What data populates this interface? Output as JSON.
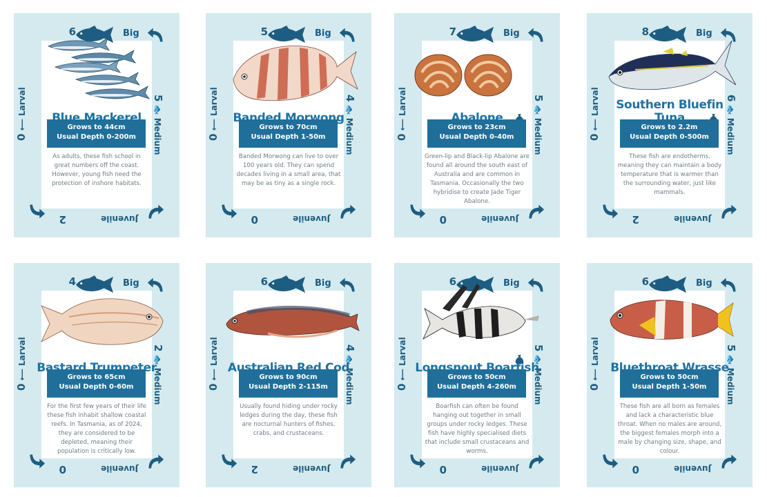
{
  "labels": {
    "big": "Big",
    "medium": "Medium",
    "juvenile": "Juvenile",
    "larval": "Larval",
    "larval_num": "0"
  },
  "colors": {
    "card_bg": "#d4eaef",
    "brand_blue": "#1f6f9a",
    "text_grey": "#6c7e86"
  },
  "cards": [
    {
      "name": "Blue Mackerel",
      "big": "6",
      "medium": "5",
      "juvenile": "2",
      "grows": "Grows to 44cm",
      "depth": "Usual Depth 0-200m",
      "desc": "As adults, these fish school in great numbers off the coast. However, young fish need the protection of inshore habitats.",
      "has_bag_icon": false,
      "illustration": "mackerel-school-illustration"
    },
    {
      "name": "Banded Morwong",
      "big": "5",
      "medium": "4",
      "juvenile": "0",
      "grows": "Grows to 70cm",
      "depth": "Usual Depth 1-50m",
      "desc": "Banded Morwong can live to over 100 years old. They can spend decades living in a small area, that may be as tiny as a single rock.",
      "has_bag_icon": false,
      "illustration": "banded-morwong-illustration"
    },
    {
      "name": "Abalone",
      "big": "7",
      "medium": "5",
      "juvenile": "0",
      "grows": "Grows to 23cm",
      "depth": "Usual Depth 0-40m",
      "desc": "Green-lip and Black-lip Abalone are found all around the south east of Australia and are common in Tasmania. Occasionally the two hybridise to create Jade Tiger Abalone.",
      "has_bag_icon": true,
      "illustration": "abalone-shells-illustration"
    },
    {
      "name": "Southern Bluefin Tuna",
      "big": "8",
      "medium": "6",
      "juvenile": "2",
      "grows": "Grows to 2.2m",
      "depth": "Usual Depth 0-500m",
      "desc": "These fish are endotherms, meaning they can maintain a body temperature that is warmer than the surrounding water, just like mammals.",
      "has_bag_icon": true,
      "illustration": "bluefin-tuna-illustration"
    },
    {
      "name": "Bastard Trumpeter",
      "big": "4",
      "medium": "2",
      "juvenile": "0",
      "grows": "Grows to 65cm",
      "depth": "Usual Depth 0-60m",
      "desc": "For the first few years of their life these fish inhabit shallow coastal reefs. In Tasmania, as of 2024, they are considered to be depleted, meaning their population is critically low.",
      "has_bag_icon": false,
      "illustration": "bastard-trumpeter-illustration"
    },
    {
      "name": "Australian Red Cod",
      "big": "6",
      "medium": "4",
      "juvenile": "2",
      "grows": "Grows to 90cm",
      "depth": "Usual Depth 2-115m",
      "desc": "Usually found hiding under rocky ledges during the day, these fish are nocturnal hunters of fishes, crabs, and crustaceans.",
      "has_bag_icon": false,
      "illustration": "red-cod-illustration"
    },
    {
      "name": "Longsnout Boarfish",
      "big": "6",
      "medium": "5",
      "juvenile": "0",
      "grows": "Grows to 50cm",
      "depth": "Usual Depth 4-260m",
      "desc": "Boarfish can often be found hanging out together in small groups under rocky ledges. These fish have highly specialised diets that include small crustaceans and worms.",
      "has_bag_icon": true,
      "illustration": "longsnout-boarfish-illustration"
    },
    {
      "name": "Bluethroat Wrasse",
      "big": "6",
      "medium": "5",
      "juvenile": "0",
      "grows": "Grows to 50cm",
      "depth": "Usual Depth 1-50m",
      "desc": "These fish are all born as females and lack a characteristic blue throat. When no males are around, the biggest females morph into a male by changing size, shape, and colour.",
      "has_bag_icon": false,
      "illustration": "bluethroat-wrasse-illustration"
    }
  ]
}
